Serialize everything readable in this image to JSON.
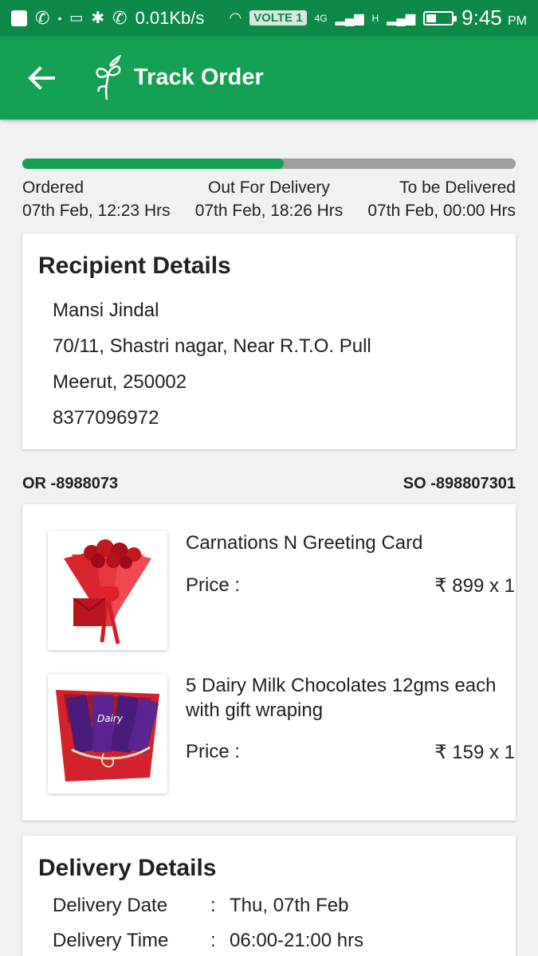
{
  "status_bar": {
    "data_speed": "0.01Kb/s",
    "volte": "VOLTE 1",
    "network_1": "4G",
    "network_2": "H",
    "time": "9:45",
    "ampm": "PM"
  },
  "app_bar": {
    "title": "Track Order",
    "back_icon": "arrow-left-icon",
    "logo_icon": "flower-logo-icon"
  },
  "progress": {
    "fraction": 0.53,
    "steps": [
      {
        "label": "Ordered",
        "time": "07th Feb, 12:23 Hrs"
      },
      {
        "label": "Out For Delivery",
        "time": "07th Feb, 18:26 Hrs"
      },
      {
        "label": "To be Delivered",
        "time": "07th Feb, 00:00 Hrs"
      }
    ]
  },
  "recipient": {
    "heading": "Recipient Details",
    "name": "Mansi Jindal",
    "address": "70/11, Shastri nagar, Near R.T.O. Pull",
    "city": "Meerut, 250002",
    "phone": "8377096972"
  },
  "order_ids": {
    "or": "OR -8988073",
    "so": "SO -898807301"
  },
  "items": [
    {
      "name": "Carnations N Greeting Card",
      "price_label": "Price :",
      "price": "₹ 899 x 1"
    },
    {
      "name": "5 Dairy Milk Chocolates 12gms each with gift wraping",
      "price_label": "Price :",
      "price": "₹ 159 x 1"
    }
  ],
  "delivery": {
    "heading": "Delivery Details",
    "rows": [
      {
        "label": "Delivery Date",
        "sep": ":",
        "value": "Thu, 07th Feb"
      },
      {
        "label": "Delivery Time",
        "sep": ":",
        "value": "06:00-21:00 hrs"
      }
    ]
  },
  "colors": {
    "status_bar": "#0e8a48",
    "app_bar": "#14a052",
    "progress_fill": "#14a052",
    "progress_track": "#9e9e9e"
  }
}
